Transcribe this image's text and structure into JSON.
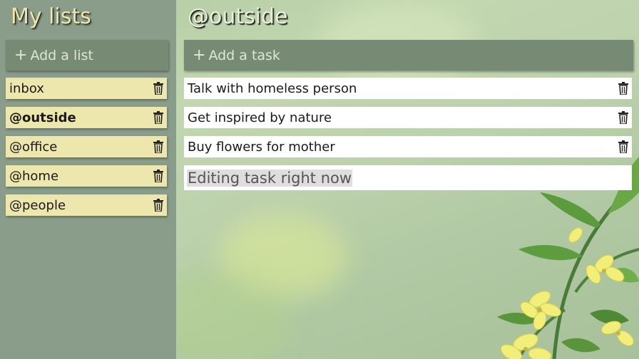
{
  "sidebar": {
    "title": "My lists",
    "add_placeholder": "Add a list",
    "lists": [
      {
        "label": "inbox",
        "active": false
      },
      {
        "label": "@outside",
        "active": true
      },
      {
        "label": "@office",
        "active": false
      },
      {
        "label": "@home",
        "active": false
      },
      {
        "label": "@people",
        "active": false
      }
    ]
  },
  "main": {
    "title": "@outside",
    "add_placeholder": "Add a task",
    "tasks": [
      {
        "label": "Talk with homeless person"
      },
      {
        "label": "Get inspired by nature"
      },
      {
        "label": "Buy flowers for mother"
      }
    ],
    "editing_task": "Editing task right now"
  },
  "colors": {
    "sidebar_bg": "#8a9c8a",
    "list_item_bg": "#ede6ad",
    "add_bar_bg": "#778a74",
    "title_color": "#efe7a8"
  },
  "icons": {
    "add": "plus-icon",
    "delete": "trash-icon"
  }
}
